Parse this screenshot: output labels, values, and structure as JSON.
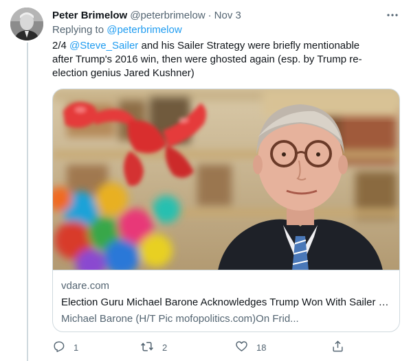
{
  "tweet": {
    "author_name": "Peter Brimelow",
    "author_handle": "@peterbrimelow",
    "separator": "·",
    "date": "Nov 3",
    "replying_prefix": "Replying to",
    "replying_to": "@peterbrimelow",
    "text_prefix": "2/4 ",
    "text_mention": "@Steve_Sailer",
    "text_body": " and his Sailer Strategy were briefly mentionable after Trump's 2016 win, then were ghosted again (esp. by Trump re-election genius Jared Kushner)"
  },
  "card": {
    "domain": "vdare.com",
    "title": "Election Guru Michael Barone Acknowledges Trump Won With Sailer S...",
    "description": "Michael Barone  (H/T Pic mofopolitics.com)On Frid..."
  },
  "actions": {
    "reply_count": "1",
    "retweet_count": "2",
    "like_count": "18"
  },
  "icons": {
    "more": "more-horizontal-icon",
    "reply": "reply-icon",
    "retweet": "retweet-icon",
    "like": "heart-icon",
    "share": "share-icon"
  },
  "colors": {
    "link": "#1d9bf0",
    "secondary_text": "#536471",
    "border": "#cfd9de"
  }
}
